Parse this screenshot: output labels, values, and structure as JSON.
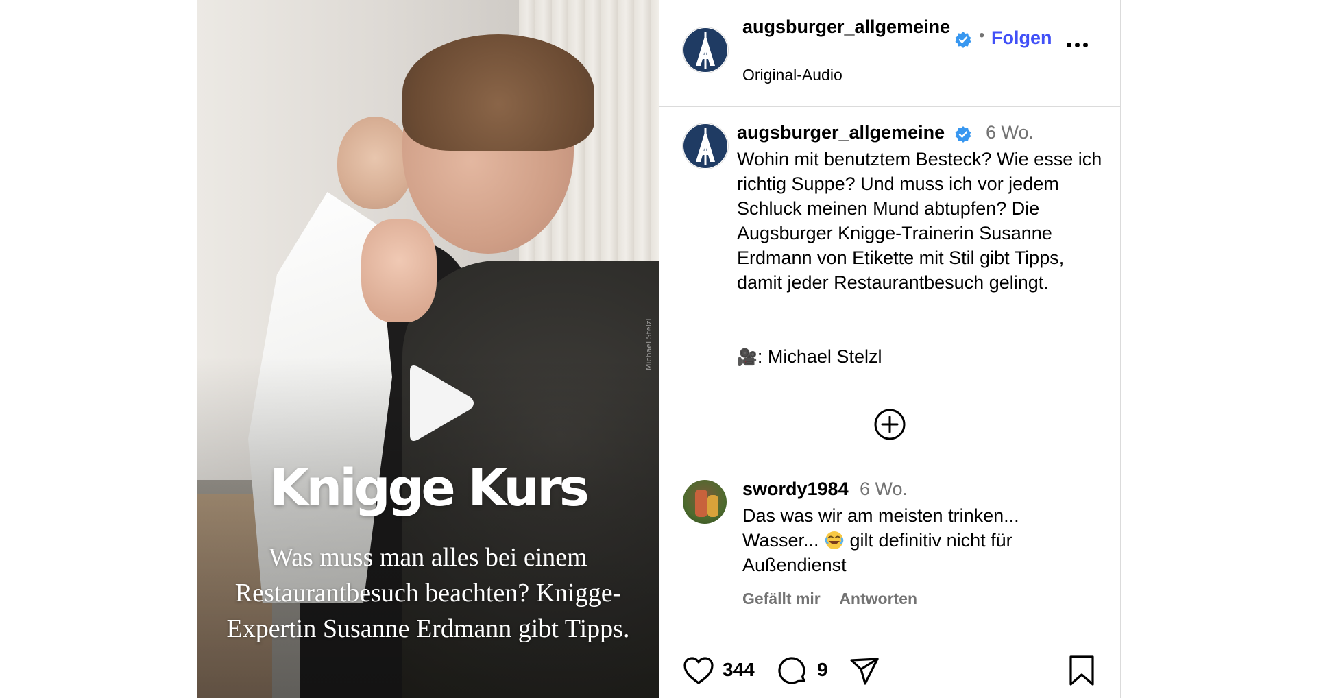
{
  "video": {
    "title": "Knigge Kurs",
    "subtitle": "Was muss man alles bei einem Restaurantbesuch beachten? Knigge-Expertin Susanne Erdmann gibt Tipps.",
    "watermark": "Michael Stelzl"
  },
  "header": {
    "username": "augsburger_allgemeine",
    "follow_label": "Folgen",
    "separator": "•",
    "audio_label": "Original-Audio"
  },
  "caption": {
    "username": "augsburger_allgemeine",
    "time": "6 Wo.",
    "text": "Wohin mit benutztem Besteck? Wie esse ich richtig Suppe? Und muss ich vor jedem Schluck meinen Mund abtupfen? Die Augsburger Knigge-Trainerin Susanne Erdmann von Etikette mit Stil gibt Tipps, damit jeder Restaurantbesuch gelingt.",
    "credit_icon": "🎥",
    "credit": ": Michael Stelzl"
  },
  "comment": {
    "username": "swordy1984",
    "time": "6 Wo.",
    "text_before": "Das was wir am meisten trinken... Wasser... ",
    "emoji": "face-with-tears-of-joy",
    "text_after": " gilt definitiv nicht für Außendienst",
    "like_label": "Gefällt mir",
    "reply_label": "Antworten"
  },
  "actions": {
    "likes": "344",
    "comments": "9"
  },
  "colors": {
    "link_blue": "#4150f7",
    "verified_blue": "#3897f0",
    "muted_text": "#737373",
    "divider": "#dbdbdb"
  }
}
